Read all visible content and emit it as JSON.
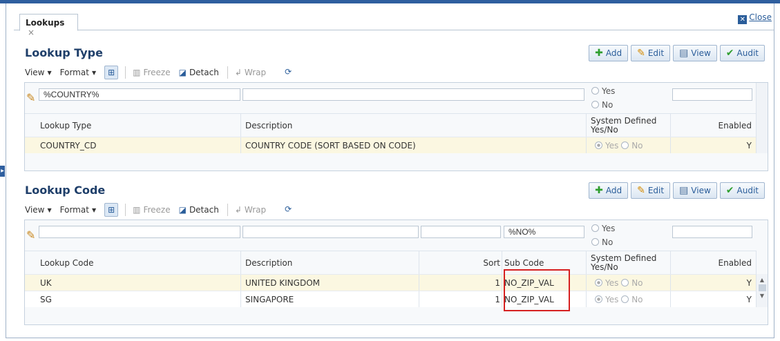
{
  "window": {
    "tab_label": "Lookups",
    "tab_close": "×",
    "close_label": "Close",
    "close_icon": "close-icon"
  },
  "lookup_type": {
    "title": "Lookup Type",
    "actions": [
      {
        "label": "Add",
        "icon": "plus-icon"
      },
      {
        "label": "Edit",
        "icon": "pencil-icon"
      },
      {
        "label": "View",
        "icon": "view-icon"
      },
      {
        "label": "Audit",
        "icon": "check-icon"
      }
    ],
    "toolbar": {
      "view": "View",
      "format": "Format",
      "freeze": "Freeze",
      "detach": "Detach",
      "wrap": "Wrap"
    },
    "filters": {
      "lookup_type": "%COUNTRY%",
      "description": "",
      "yes": "Yes",
      "no": "No",
      "enabled": ""
    },
    "columns": {
      "lookup_type": "Lookup Type",
      "description": "Description",
      "system_defined": "System Defined Yes/No",
      "enabled": "Enabled"
    },
    "rows": [
      {
        "lookup_type": "COUNTRY_CD",
        "description": "COUNTRY CODE (SORT BASED ON CODE)",
        "yes": "Yes",
        "no": "No",
        "enabled": "Y"
      }
    ]
  },
  "lookup_code": {
    "title": "Lookup Code",
    "actions": [
      {
        "label": "Add",
        "icon": "plus-icon"
      },
      {
        "label": "Edit",
        "icon": "pencil-icon"
      },
      {
        "label": "View",
        "icon": "view-icon"
      },
      {
        "label": "Audit",
        "icon": "check-icon"
      }
    ],
    "toolbar": {
      "view": "View",
      "format": "Format",
      "freeze": "Freeze",
      "detach": "Detach",
      "wrap": "Wrap"
    },
    "filters": {
      "lookup_code": "",
      "description": "",
      "sort": "",
      "sub_code": "%NO%",
      "yes": "Yes",
      "no": "No",
      "enabled": ""
    },
    "columns": {
      "lookup_code": "Lookup Code",
      "description": "Description",
      "sort": "Sort",
      "sub_code": "Sub Code",
      "system_defined": "System Defined Yes/No",
      "enabled": "Enabled"
    },
    "rows": [
      {
        "lookup_code": "UK",
        "description": "UNITED KINGDOM",
        "sort": "1",
        "sub_code": "NO_ZIP_VAL",
        "yes": "Yes",
        "no": "No",
        "enabled": "Y"
      },
      {
        "lookup_code": "SG",
        "description": "SINGAPORE",
        "sort": "1",
        "sub_code": "NO_ZIP_VAL",
        "yes": "Yes",
        "no": "No",
        "enabled": "Y"
      }
    ]
  },
  "colors": {
    "title": "#1f3f6a",
    "accent": "#2a5d9a",
    "selected_row": "#fbf7e1",
    "highlight": "#d62020"
  }
}
